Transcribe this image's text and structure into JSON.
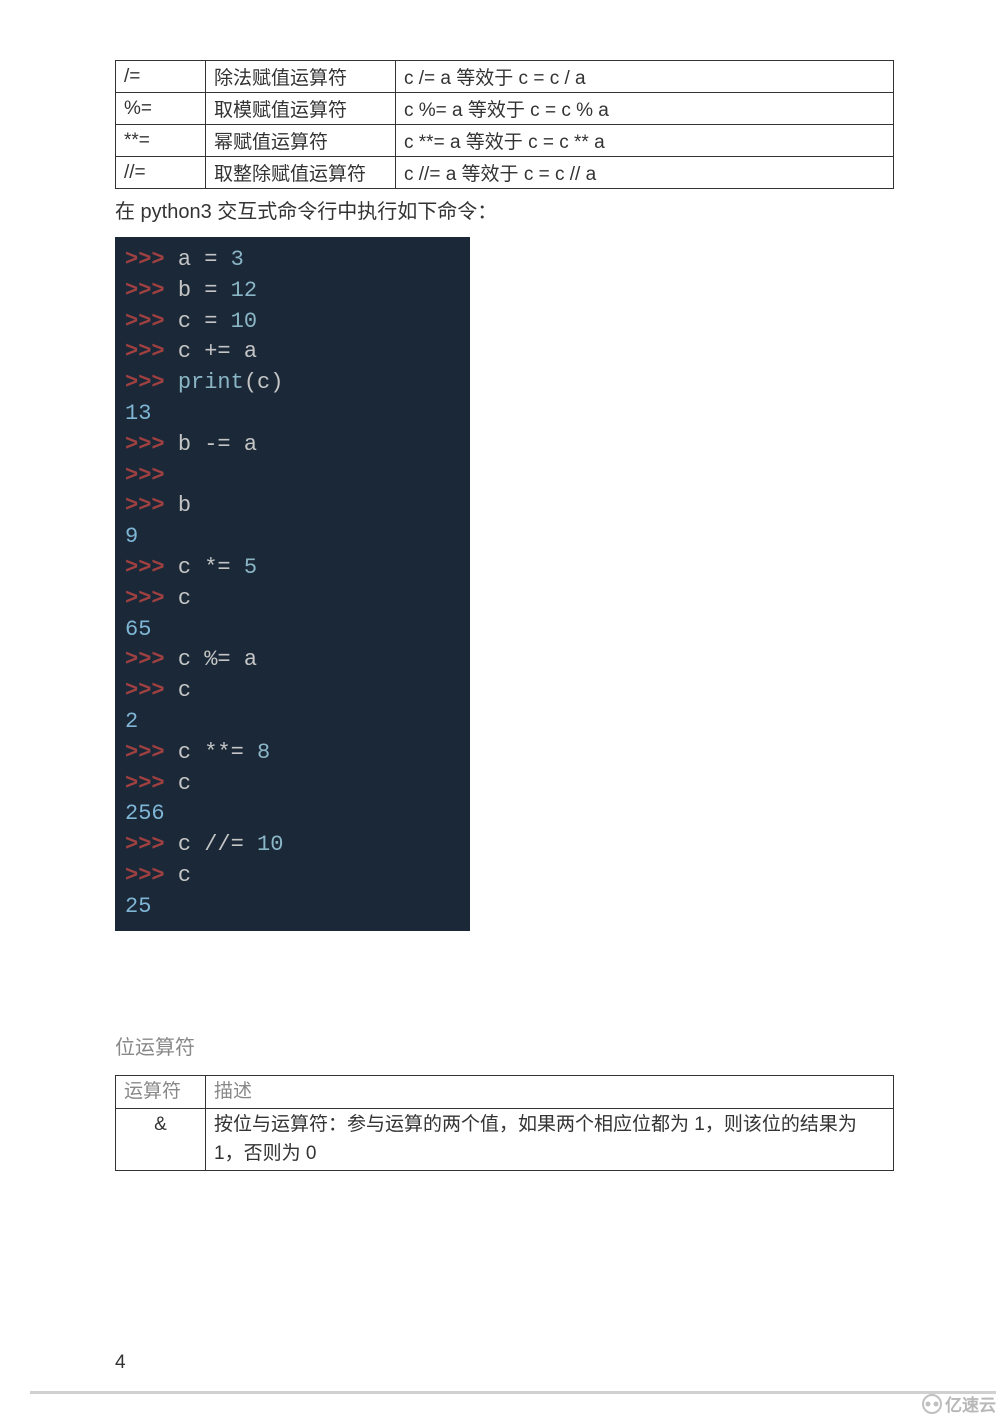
{
  "table1": {
    "rows": [
      {
        "op": "/=",
        "desc": "除法赋值运算符",
        "example": "c /= a 等效于 c = c / a"
      },
      {
        "op": "%=",
        "desc": "取模赋值运算符",
        "example": "c %= a 等效于 c = c % a"
      },
      {
        "op": "**=",
        "desc": "幂赋值运算符",
        "example": "c **= a 等效于 c = c ** a"
      },
      {
        "op": "//=",
        "desc": "取整除赋值运算符",
        "example": "c //= a 等效于 c = c // a"
      }
    ]
  },
  "paragraph": "在 python3 交互式命令行中执行如下命令：",
  "terminal": {
    "lines": [
      {
        "type": "input",
        "parts": [
          {
            "t": "prompt",
            "v": ">>> "
          },
          {
            "t": "var",
            "v": "a"
          },
          {
            "t": "op",
            "v": " = "
          },
          {
            "t": "num",
            "v": "3"
          }
        ]
      },
      {
        "type": "input",
        "parts": [
          {
            "t": "prompt",
            "v": ">>> "
          },
          {
            "t": "var",
            "v": "b"
          },
          {
            "t": "op",
            "v": " = "
          },
          {
            "t": "num",
            "v": "12"
          }
        ]
      },
      {
        "type": "input",
        "parts": [
          {
            "t": "prompt",
            "v": ">>> "
          },
          {
            "t": "var",
            "v": "c"
          },
          {
            "t": "op",
            "v": " = "
          },
          {
            "t": "num",
            "v": "10"
          }
        ]
      },
      {
        "type": "input",
        "parts": [
          {
            "t": "prompt",
            "v": ">>> "
          },
          {
            "t": "var",
            "v": "c"
          },
          {
            "t": "op",
            "v": " += "
          },
          {
            "t": "var",
            "v": "a"
          }
        ]
      },
      {
        "type": "input",
        "parts": [
          {
            "t": "prompt",
            "v": ">>> "
          },
          {
            "t": "fname",
            "v": "print"
          },
          {
            "t": "paren",
            "v": "("
          },
          {
            "t": "var",
            "v": "c"
          },
          {
            "t": "paren",
            "v": ")"
          }
        ]
      },
      {
        "type": "output",
        "parts": [
          {
            "t": "output",
            "v": "13"
          }
        ]
      },
      {
        "type": "input",
        "parts": [
          {
            "t": "prompt",
            "v": ">>> "
          },
          {
            "t": "var",
            "v": "b"
          },
          {
            "t": "op",
            "v": " -= "
          },
          {
            "t": "var",
            "v": "a"
          }
        ]
      },
      {
        "type": "input",
        "parts": [
          {
            "t": "prompt",
            "v": ">>> "
          }
        ]
      },
      {
        "type": "input",
        "parts": [
          {
            "t": "prompt",
            "v": ">>> "
          },
          {
            "t": "var",
            "v": "b"
          }
        ]
      },
      {
        "type": "output",
        "parts": [
          {
            "t": "output",
            "v": "9"
          }
        ]
      },
      {
        "type": "input",
        "parts": [
          {
            "t": "prompt",
            "v": ">>> "
          },
          {
            "t": "var",
            "v": "c"
          },
          {
            "t": "op",
            "v": " *= "
          },
          {
            "t": "num",
            "v": "5"
          }
        ]
      },
      {
        "type": "input",
        "parts": [
          {
            "t": "prompt",
            "v": ">>> "
          },
          {
            "t": "var",
            "v": "c"
          }
        ]
      },
      {
        "type": "output",
        "parts": [
          {
            "t": "output",
            "v": "65"
          }
        ]
      },
      {
        "type": "input",
        "parts": [
          {
            "t": "prompt",
            "v": ">>> "
          },
          {
            "t": "var",
            "v": "c"
          },
          {
            "t": "op",
            "v": " %= "
          },
          {
            "t": "var",
            "v": "a"
          }
        ]
      },
      {
        "type": "input",
        "parts": [
          {
            "t": "prompt",
            "v": ">>> "
          },
          {
            "t": "var",
            "v": "c"
          }
        ]
      },
      {
        "type": "output",
        "parts": [
          {
            "t": "output",
            "v": "2"
          }
        ]
      },
      {
        "type": "input",
        "parts": [
          {
            "t": "prompt",
            "v": ">>> "
          },
          {
            "t": "var",
            "v": "c"
          },
          {
            "t": "op",
            "v": " **= "
          },
          {
            "t": "num",
            "v": "8"
          }
        ]
      },
      {
        "type": "input",
        "parts": [
          {
            "t": "prompt",
            "v": ">>> "
          },
          {
            "t": "var",
            "v": "c"
          }
        ]
      },
      {
        "type": "output",
        "parts": [
          {
            "t": "output",
            "v": "256"
          }
        ]
      },
      {
        "type": "input",
        "parts": [
          {
            "t": "prompt",
            "v": ">>> "
          },
          {
            "t": "var",
            "v": "c"
          },
          {
            "t": "op",
            "v": " //= "
          },
          {
            "t": "num",
            "v": "10"
          }
        ]
      },
      {
        "type": "input",
        "parts": [
          {
            "t": "prompt",
            "v": ">>> "
          },
          {
            "t": "var",
            "v": "c"
          }
        ]
      },
      {
        "type": "output",
        "parts": [
          {
            "t": "output",
            "v": "25"
          }
        ]
      }
    ]
  },
  "section_title": "位运算符",
  "table2": {
    "header": {
      "col1": "运算符",
      "col2": "描述"
    },
    "rows": [
      {
        "op": "&",
        "desc": "按位与运算符：参与运算的两个值，如果两个相应位都为 1，则该位的结果为 1，否则为 0"
      }
    ]
  },
  "page_number": "4",
  "footer_brand": "亿速云"
}
